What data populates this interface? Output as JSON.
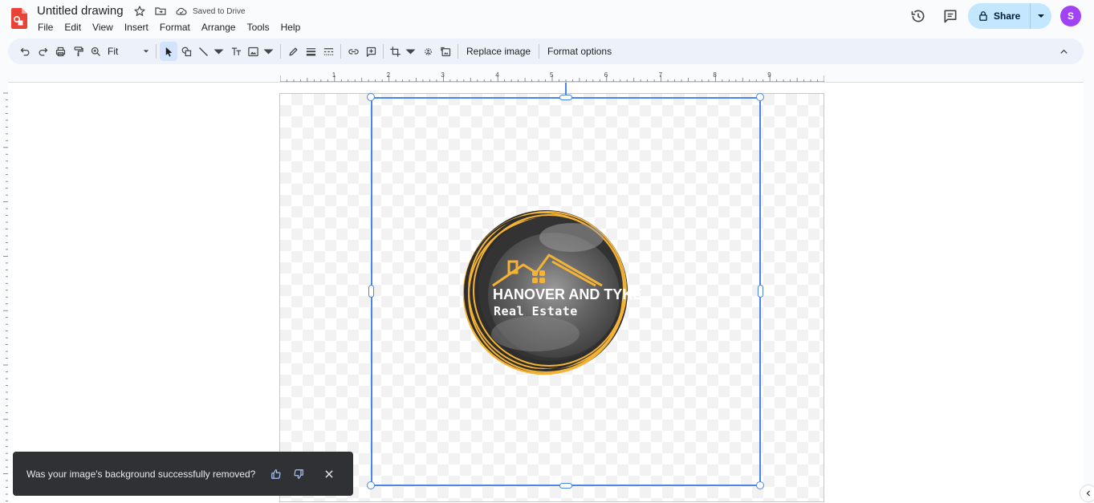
{
  "header": {
    "doc_title": "Untitled drawing",
    "saved_status": "Saved to Drive",
    "share_label": "Share",
    "avatar_initial": "S"
  },
  "menu": [
    "File",
    "Edit",
    "View",
    "Insert",
    "Format",
    "Arrange",
    "Tools",
    "Help"
  ],
  "toolbar": {
    "zoom_value": "Fit",
    "replace_image_label": "Replace image",
    "format_options_label": "Format options"
  },
  "ruler": {
    "ticks": [
      "1",
      "2",
      "3",
      "4",
      "5",
      "6",
      "7",
      "8",
      "9"
    ]
  },
  "canvas": {
    "logo_title": "HANOVER AND TYKE",
    "logo_subtitle": "Real Estate"
  },
  "snackbar": {
    "message": "Was your image's background successfully removed?"
  },
  "colors": {
    "accent": "#4a86e8",
    "share_bg": "#c2e7ff",
    "avatar_bg": "#a142f4",
    "logo_gold": "#f5b335",
    "snackbar_bg": "#303134"
  }
}
